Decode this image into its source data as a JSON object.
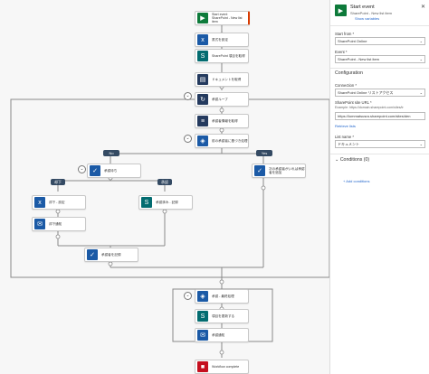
{
  "canvas": {
    "nodes": [
      {
        "id": "start",
        "label": "Start event\nSharePoint - New list item",
        "icon": "play-icon",
        "color": "green"
      },
      {
        "id": "n1",
        "label": "書式を設定",
        "icon": "expression-icon",
        "color": "blue"
      },
      {
        "id": "n2",
        "label": "SharePoint 項目を取得",
        "icon": "sharepoint-icon",
        "color": "teal"
      },
      {
        "id": "n3",
        "label": "ドキュメントを取得",
        "icon": "document-icon",
        "color": "navy"
      },
      {
        "id": "n4",
        "label": "承認ループ",
        "icon": "loop-icon",
        "color": "navy"
      },
      {
        "id": "n5",
        "label": "承認者情報を取得",
        "icon": "list-icon",
        "color": "navy"
      },
      {
        "id": "n6",
        "label": "前の承認者に基づき処理",
        "icon": "condition-icon",
        "color": "blue"
      },
      {
        "id": "n7",
        "label": "承認待ち",
        "icon": "approval-icon",
        "color": "blue"
      },
      {
        "id": "n8",
        "label": "次の承認者がいれば承認者を追加",
        "icon": "approval-icon",
        "color": "blue"
      },
      {
        "id": "n9",
        "label": "却下 - 設定",
        "icon": "expression-icon",
        "color": "blue"
      },
      {
        "id": "n10",
        "label": "承認済み - 記録",
        "icon": "sharepoint-icon",
        "color": "teal"
      },
      {
        "id": "n11",
        "label": "却下通知",
        "icon": "mail-icon",
        "color": "blue"
      },
      {
        "id": "n12",
        "label": "承認者を記録",
        "icon": "approval-icon",
        "color": "blue"
      },
      {
        "id": "n13",
        "label": "承認 - 最終処理",
        "icon": "condition-icon",
        "color": "blue"
      },
      {
        "id": "n14",
        "label": "項目を更新する",
        "icon": "sharepoint-icon",
        "color": "teal"
      },
      {
        "id": "n15",
        "label": "承認通知",
        "icon": "mail-icon",
        "color": "blue"
      },
      {
        "id": "end",
        "label": "Workflow complete",
        "icon": "stop-icon",
        "color": "red"
      }
    ],
    "branches": {
      "no": "No",
      "yes": "Yes",
      "reject": "却下",
      "approve": "承認"
    }
  },
  "panel": {
    "title": "Start event",
    "subtitle": "SharePoint - New list item",
    "show_vars": "Show variables",
    "start_from_label": "Start from *",
    "start_from_value": "SharePoint Online",
    "event_label": "Event *",
    "event_value": "SharePoint - New list item",
    "config_heading": "Configuration",
    "connection_label": "Connection *",
    "connection_value": "SharePoint Online リストアクセス",
    "site_label": "SharePoint site URL *",
    "site_help": "Example: https://domain.sharepoint.com/sites/tr",
    "site_value": "https://lommatsusra.sharepoint.com/sites/den",
    "retrieve_lists": "Retrieve lists",
    "list_label": "List name *",
    "list_value": "ドキュメント",
    "conditions_heading": "Conditions (0)",
    "add_conditions": "Add conditions"
  }
}
